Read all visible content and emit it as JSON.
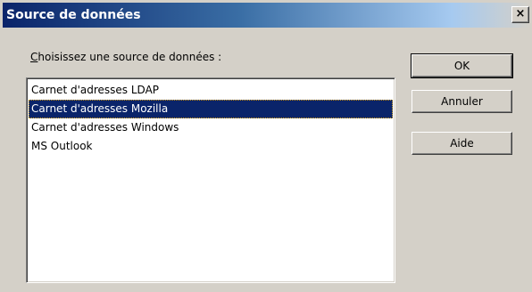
{
  "window": {
    "title": "Source de données",
    "close_glyph": "×"
  },
  "prompt": {
    "mnemonic": "C",
    "rest": "hoisissez une source de données :"
  },
  "list": {
    "items": [
      {
        "label": "Carnet d'adresses LDAP",
        "selected": false
      },
      {
        "label": "Carnet d'adresses Mozilla",
        "selected": true
      },
      {
        "label": "Carnet d'adresses Windows",
        "selected": false
      },
      {
        "label": "MS Outlook",
        "selected": false
      }
    ]
  },
  "buttons": {
    "ok_label": "OK",
    "cancel_label": "Annuler",
    "help_label": "Aide"
  },
  "colors": {
    "titlebar": "#0a246a",
    "selection": "#0a246a",
    "face": "#d4d0c8"
  },
  "icons": {
    "close": "close-icon"
  }
}
